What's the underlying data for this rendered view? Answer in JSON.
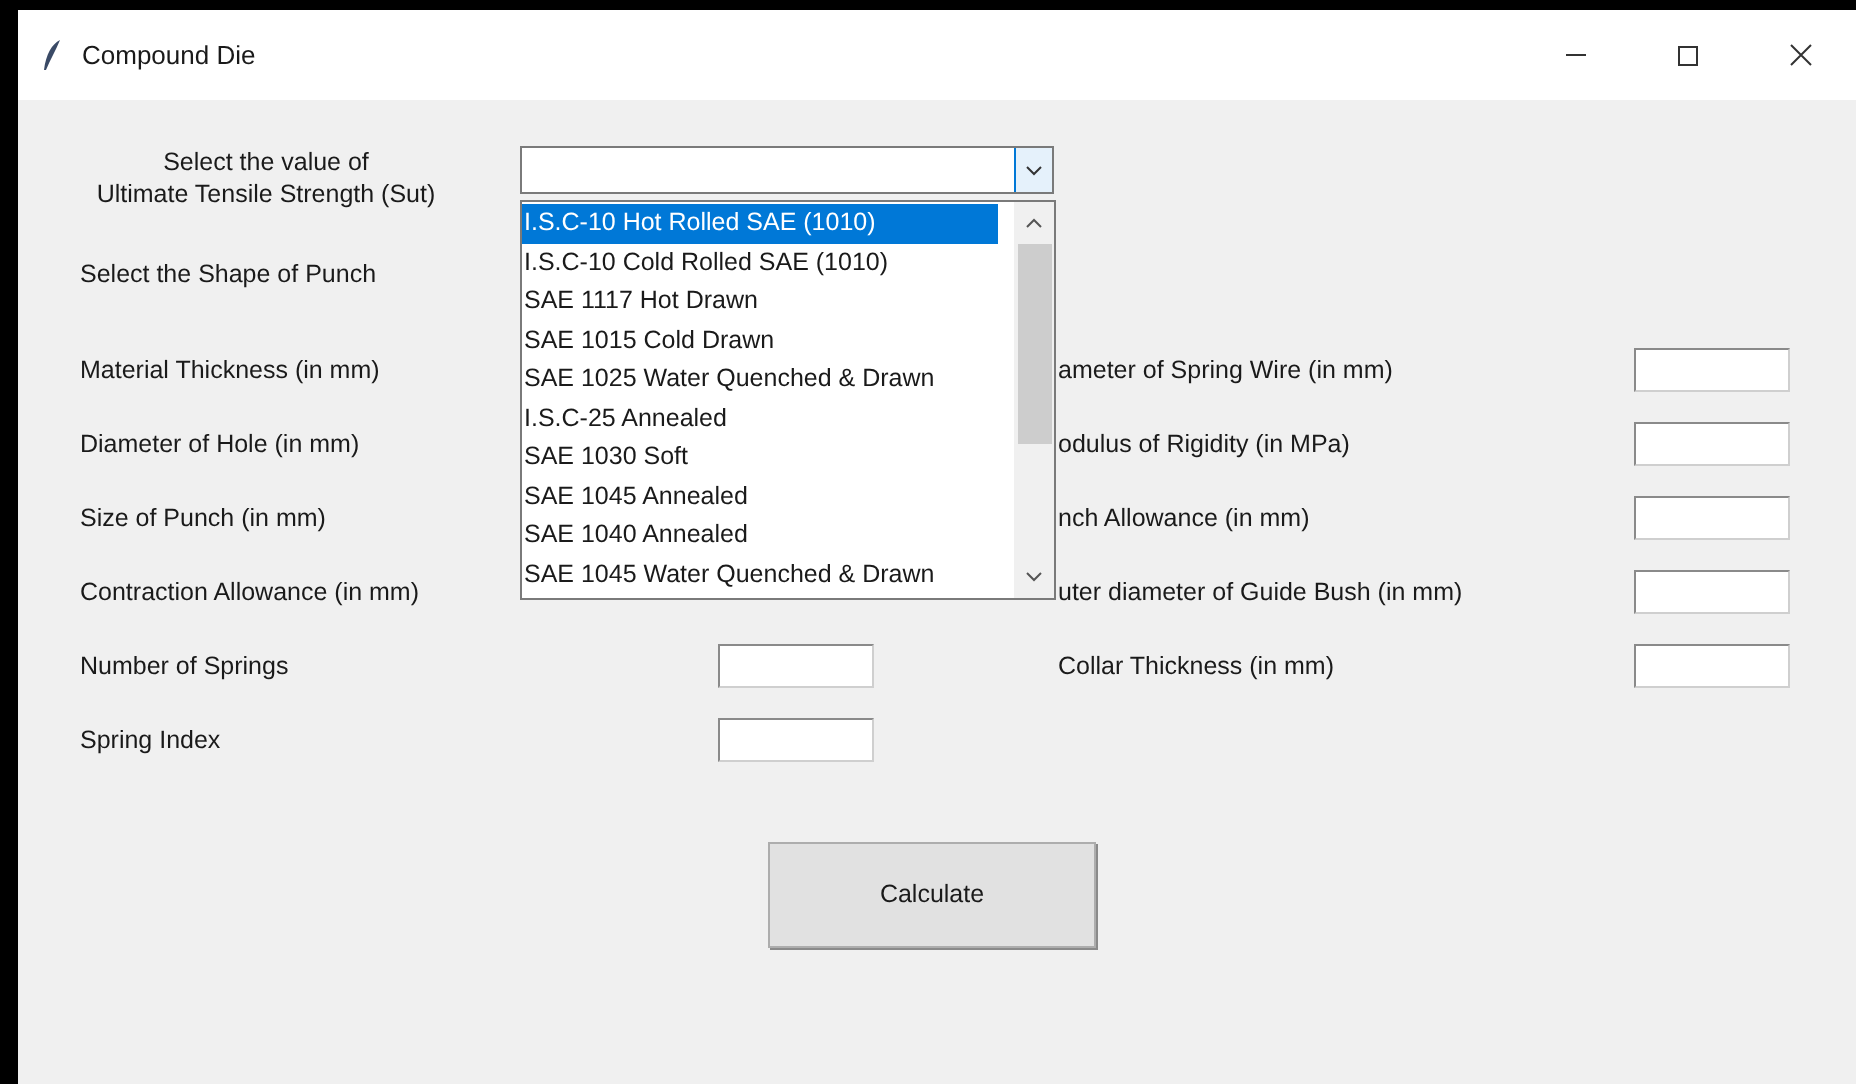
{
  "window": {
    "title": "Compound Die"
  },
  "sut": {
    "label_lines": [
      "Select the value of",
      "Ultimate Tensile Strength (Sut)"
    ],
    "expanded": true,
    "options": [
      {
        "label": "I.S.C-10 Hot Rolled SAE (1010)",
        "selected": true
      },
      {
        "label": "I.S.C-10 Cold Rolled SAE (1010)",
        "selected": false
      },
      {
        "label": "SAE 1117 Hot Drawn",
        "selected": false
      },
      {
        "label": "SAE 1015 Cold Drawn",
        "selected": false
      },
      {
        "label": "SAE 1025 Water Quenched & Drawn",
        "selected": false
      },
      {
        "label": "I.S.C-25 Annealed",
        "selected": false
      },
      {
        "label": "SAE 1030 Soft",
        "selected": false
      },
      {
        "label": "SAE 1045 Annealed",
        "selected": false
      },
      {
        "label": "SAE 1040 Annealed",
        "selected": false
      },
      {
        "label": "SAE 1045 Water Quenched & Drawn",
        "selected": false
      }
    ]
  },
  "shape": {
    "label": "Select the Shape of Punch"
  },
  "left_fields": [
    {
      "label": "Material Thickness (in mm)",
      "kind": "covered"
    },
    {
      "label": "Diameter of Hole (in mm)",
      "kind": "covered"
    },
    {
      "label": "Size of Punch (in mm)",
      "kind": "covered"
    },
    {
      "label": "Contraction Allowance (in mm)",
      "kind": "covered"
    },
    {
      "label": "Number of Springs",
      "kind": "entry"
    },
    {
      "label": "Spring Index",
      "kind": "entry"
    }
  ],
  "right_fields": [
    {
      "label": "ameter of Spring Wire (in mm)"
    },
    {
      "label": "odulus of Rigidity (in MPa)"
    },
    {
      "label": "nch Allowance (in mm)"
    },
    {
      "label": "uter diameter of Guide Bush (in mm)"
    },
    {
      "label": "Collar Thickness (in mm)"
    }
  ],
  "button": "Calculate"
}
